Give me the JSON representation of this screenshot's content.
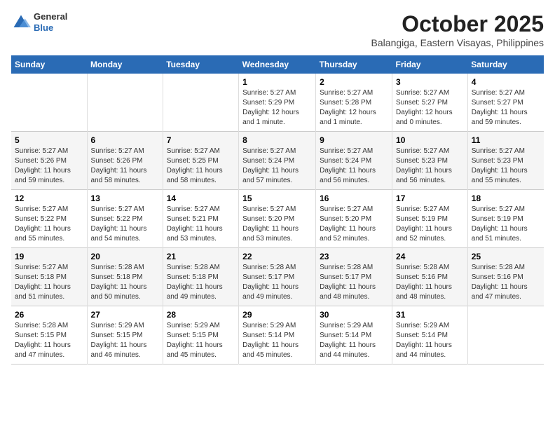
{
  "header": {
    "logo_general": "General",
    "logo_blue": "Blue",
    "month_title": "October 2025",
    "location": "Balangiga, Eastern Visayas, Philippines"
  },
  "days_of_week": [
    "Sunday",
    "Monday",
    "Tuesday",
    "Wednesday",
    "Thursday",
    "Friday",
    "Saturday"
  ],
  "weeks": [
    [
      {
        "num": "",
        "sunrise": "",
        "sunset": "",
        "daylight": ""
      },
      {
        "num": "",
        "sunrise": "",
        "sunset": "",
        "daylight": ""
      },
      {
        "num": "",
        "sunrise": "",
        "sunset": "",
        "daylight": ""
      },
      {
        "num": "1",
        "sunrise": "Sunrise: 5:27 AM",
        "sunset": "Sunset: 5:29 PM",
        "daylight": "Daylight: 12 hours and 1 minute."
      },
      {
        "num": "2",
        "sunrise": "Sunrise: 5:27 AM",
        "sunset": "Sunset: 5:28 PM",
        "daylight": "Daylight: 12 hours and 1 minute."
      },
      {
        "num": "3",
        "sunrise": "Sunrise: 5:27 AM",
        "sunset": "Sunset: 5:27 PM",
        "daylight": "Daylight: 12 hours and 0 minutes."
      },
      {
        "num": "4",
        "sunrise": "Sunrise: 5:27 AM",
        "sunset": "Sunset: 5:27 PM",
        "daylight": "Daylight: 11 hours and 59 minutes."
      }
    ],
    [
      {
        "num": "5",
        "sunrise": "Sunrise: 5:27 AM",
        "sunset": "Sunset: 5:26 PM",
        "daylight": "Daylight: 11 hours and 59 minutes."
      },
      {
        "num": "6",
        "sunrise": "Sunrise: 5:27 AM",
        "sunset": "Sunset: 5:26 PM",
        "daylight": "Daylight: 11 hours and 58 minutes."
      },
      {
        "num": "7",
        "sunrise": "Sunrise: 5:27 AM",
        "sunset": "Sunset: 5:25 PM",
        "daylight": "Daylight: 11 hours and 58 minutes."
      },
      {
        "num": "8",
        "sunrise": "Sunrise: 5:27 AM",
        "sunset": "Sunset: 5:24 PM",
        "daylight": "Daylight: 11 hours and 57 minutes."
      },
      {
        "num": "9",
        "sunrise": "Sunrise: 5:27 AM",
        "sunset": "Sunset: 5:24 PM",
        "daylight": "Daylight: 11 hours and 56 minutes."
      },
      {
        "num": "10",
        "sunrise": "Sunrise: 5:27 AM",
        "sunset": "Sunset: 5:23 PM",
        "daylight": "Daylight: 11 hours and 56 minutes."
      },
      {
        "num": "11",
        "sunrise": "Sunrise: 5:27 AM",
        "sunset": "Sunset: 5:23 PM",
        "daylight": "Daylight: 11 hours and 55 minutes."
      }
    ],
    [
      {
        "num": "12",
        "sunrise": "Sunrise: 5:27 AM",
        "sunset": "Sunset: 5:22 PM",
        "daylight": "Daylight: 11 hours and 55 minutes."
      },
      {
        "num": "13",
        "sunrise": "Sunrise: 5:27 AM",
        "sunset": "Sunset: 5:22 PM",
        "daylight": "Daylight: 11 hours and 54 minutes."
      },
      {
        "num": "14",
        "sunrise": "Sunrise: 5:27 AM",
        "sunset": "Sunset: 5:21 PM",
        "daylight": "Daylight: 11 hours and 53 minutes."
      },
      {
        "num": "15",
        "sunrise": "Sunrise: 5:27 AM",
        "sunset": "Sunset: 5:20 PM",
        "daylight": "Daylight: 11 hours and 53 minutes."
      },
      {
        "num": "16",
        "sunrise": "Sunrise: 5:27 AM",
        "sunset": "Sunset: 5:20 PM",
        "daylight": "Daylight: 11 hours and 52 minutes."
      },
      {
        "num": "17",
        "sunrise": "Sunrise: 5:27 AM",
        "sunset": "Sunset: 5:19 PM",
        "daylight": "Daylight: 11 hours and 52 minutes."
      },
      {
        "num": "18",
        "sunrise": "Sunrise: 5:27 AM",
        "sunset": "Sunset: 5:19 PM",
        "daylight": "Daylight: 11 hours and 51 minutes."
      }
    ],
    [
      {
        "num": "19",
        "sunrise": "Sunrise: 5:27 AM",
        "sunset": "Sunset: 5:18 PM",
        "daylight": "Daylight: 11 hours and 51 minutes."
      },
      {
        "num": "20",
        "sunrise": "Sunrise: 5:28 AM",
        "sunset": "Sunset: 5:18 PM",
        "daylight": "Daylight: 11 hours and 50 minutes."
      },
      {
        "num": "21",
        "sunrise": "Sunrise: 5:28 AM",
        "sunset": "Sunset: 5:18 PM",
        "daylight": "Daylight: 11 hours and 49 minutes."
      },
      {
        "num": "22",
        "sunrise": "Sunrise: 5:28 AM",
        "sunset": "Sunset: 5:17 PM",
        "daylight": "Daylight: 11 hours and 49 minutes."
      },
      {
        "num": "23",
        "sunrise": "Sunrise: 5:28 AM",
        "sunset": "Sunset: 5:17 PM",
        "daylight": "Daylight: 11 hours and 48 minutes."
      },
      {
        "num": "24",
        "sunrise": "Sunrise: 5:28 AM",
        "sunset": "Sunset: 5:16 PM",
        "daylight": "Daylight: 11 hours and 48 minutes."
      },
      {
        "num": "25",
        "sunrise": "Sunrise: 5:28 AM",
        "sunset": "Sunset: 5:16 PM",
        "daylight": "Daylight: 11 hours and 47 minutes."
      }
    ],
    [
      {
        "num": "26",
        "sunrise": "Sunrise: 5:28 AM",
        "sunset": "Sunset: 5:15 PM",
        "daylight": "Daylight: 11 hours and 47 minutes."
      },
      {
        "num": "27",
        "sunrise": "Sunrise: 5:29 AM",
        "sunset": "Sunset: 5:15 PM",
        "daylight": "Daylight: 11 hours and 46 minutes."
      },
      {
        "num": "28",
        "sunrise": "Sunrise: 5:29 AM",
        "sunset": "Sunset: 5:15 PM",
        "daylight": "Daylight: 11 hours and 45 minutes."
      },
      {
        "num": "29",
        "sunrise": "Sunrise: 5:29 AM",
        "sunset": "Sunset: 5:14 PM",
        "daylight": "Daylight: 11 hours and 45 minutes."
      },
      {
        "num": "30",
        "sunrise": "Sunrise: 5:29 AM",
        "sunset": "Sunset: 5:14 PM",
        "daylight": "Daylight: 11 hours and 44 minutes."
      },
      {
        "num": "31",
        "sunrise": "Sunrise: 5:29 AM",
        "sunset": "Sunset: 5:14 PM",
        "daylight": "Daylight: 11 hours and 44 minutes."
      },
      {
        "num": "",
        "sunrise": "",
        "sunset": "",
        "daylight": ""
      }
    ]
  ]
}
